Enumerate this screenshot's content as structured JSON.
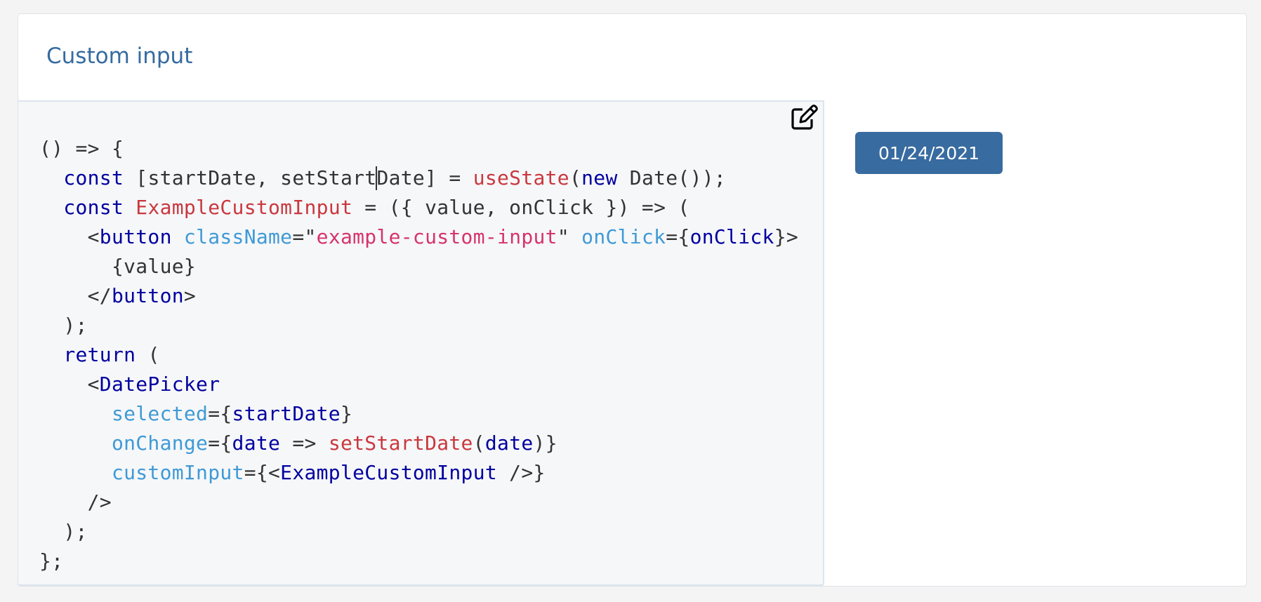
{
  "example": {
    "title": "Custom input",
    "edit_icon": "edit-icon",
    "date_button_value": "01/24/2021",
    "code_lines": [
      [
        [
          "() => {",
          ""
        ]
      ],
      [
        [
          "  ",
          ""
        ],
        [
          "const",
          "kw"
        ],
        [
          " [startDate, setStart",
          ""
        ],
        [
          "|",
          "caret"
        ],
        [
          "Date] = ",
          ""
        ],
        [
          "useState",
          "fn"
        ],
        [
          "(",
          ""
        ],
        [
          "new",
          "kw"
        ],
        [
          " Date());",
          ""
        ]
      ],
      [
        [
          "  ",
          ""
        ],
        [
          "const",
          "kw"
        ],
        [
          " ",
          ""
        ],
        [
          "ExampleCustomInput",
          "fn"
        ],
        [
          " = ({ value, onClick }) => (",
          ""
        ]
      ],
      [
        [
          "    <",
          ""
        ],
        [
          "button",
          "kw"
        ],
        [
          " ",
          ""
        ],
        [
          "className",
          "attr"
        ],
        [
          "=\"",
          ""
        ],
        [
          "example-custom-input",
          "str"
        ],
        [
          "\" ",
          ""
        ],
        [
          "onClick",
          "attr"
        ],
        [
          "={",
          ""
        ],
        [
          "onClick",
          "kw"
        ],
        [
          "}>",
          ""
        ]
      ],
      [
        [
          "      {value}",
          ""
        ]
      ],
      [
        [
          "    </",
          ""
        ],
        [
          "button",
          "kw"
        ],
        [
          ">",
          ""
        ]
      ],
      [
        [
          "  );",
          ""
        ]
      ],
      [
        [
          "  ",
          ""
        ],
        [
          "return",
          "kw"
        ],
        [
          " (",
          ""
        ]
      ],
      [
        [
          "    <",
          ""
        ],
        [
          "DatePicker",
          "kw"
        ]
      ],
      [
        [
          "      ",
          ""
        ],
        [
          "selected",
          "attr"
        ],
        [
          "={",
          ""
        ],
        [
          "startDate",
          "kw"
        ],
        [
          "}",
          ""
        ]
      ],
      [
        [
          "      ",
          ""
        ],
        [
          "onChange",
          "attr"
        ],
        [
          "={",
          ""
        ],
        [
          "date",
          "kw"
        ],
        [
          " => ",
          ""
        ],
        [
          "setStartDate",
          "fn"
        ],
        [
          "(",
          ""
        ],
        [
          "date",
          "kw"
        ],
        [
          ")}",
          ""
        ]
      ],
      [
        [
          "      ",
          ""
        ],
        [
          "customInput",
          "attr"
        ],
        [
          "={<",
          ""
        ],
        [
          "ExampleCustomInput",
          "kw"
        ],
        [
          " />}",
          ""
        ]
      ],
      [
        [
          "    />",
          ""
        ]
      ],
      [
        [
          "  );",
          ""
        ]
      ],
      [
        [
          "};",
          ""
        ]
      ]
    ]
  }
}
